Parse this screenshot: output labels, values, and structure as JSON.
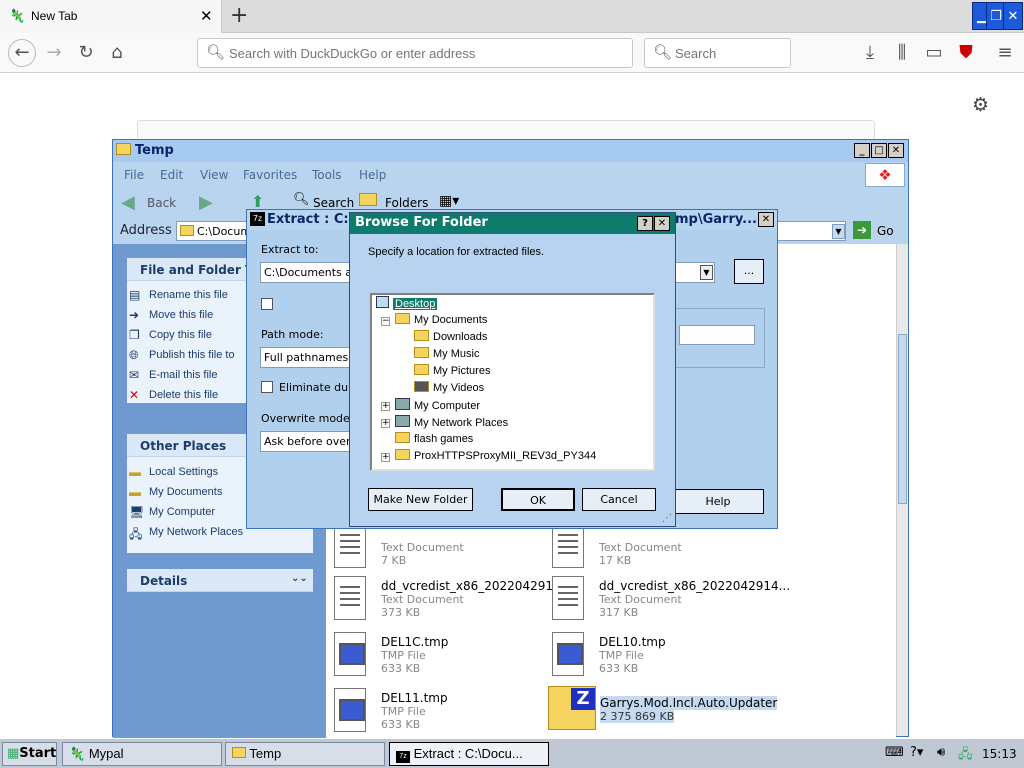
{
  "browser": {
    "tab_title": "New Tab",
    "url_placeholder": "Search with DuckDuckGo or enter address",
    "search_placeholder": "Search"
  },
  "explorer": {
    "title": "Temp",
    "menu": [
      "File",
      "Edit",
      "View",
      "Favorites",
      "Tools",
      "Help"
    ],
    "toolbar": {
      "back": "Back",
      "search": "Search",
      "folders": "Folders"
    },
    "address_label": "Address",
    "address_value": "C:\\Docum",
    "go_label": "Go",
    "file_tasks": {
      "heading": "File and Folder Tas",
      "items": [
        "Rename this file",
        "Move this file",
        "Copy this file",
        "Publish this file to",
        "E-mail this file",
        "Delete this file"
      ]
    },
    "other_places": {
      "heading": "Other Places",
      "items": [
        "Local Settings",
        "My Documents",
        "My Computer",
        "My Network Places"
      ]
    },
    "details_heading": "Details",
    "files": [
      {
        "name": "",
        "type": "Text Document",
        "size": "7 KB"
      },
      {
        "name": "",
        "type": "Text Document",
        "size": "17 KB"
      },
      {
        "name": "dd_vcredist_x86_2022042914...",
        "type": "Text Document",
        "size": "373 KB"
      },
      {
        "name": "dd_vcredist_x86_2022042914...",
        "type": "Text Document",
        "size": "317 KB"
      },
      {
        "name": "DEL1C.tmp",
        "type": "TMP File",
        "size": "633 KB"
      },
      {
        "name": "DEL10.tmp",
        "type": "TMP File",
        "size": "633 KB"
      },
      {
        "name": "DEL11.tmp",
        "type": "TMP File",
        "size": "633 KB"
      },
      {
        "name": "Garrys.Mod.Incl.Auto.Updater",
        "type": "",
        "size": "2 375 869 KB"
      }
    ]
  },
  "extract": {
    "title": "Extract : C:\\",
    "title_right": "mp\\Garry...",
    "extract_to_label": "Extract to:",
    "extract_to_value": "C:\\Documents and",
    "browse_button": "...",
    "path_mode_label": "Path mode:",
    "path_mode_value": "Full pathnames",
    "eliminate_label": "Eliminate duplic",
    "overwrite_label": "Overwrite mode:",
    "overwrite_value": "Ask before overw",
    "help_button": "Help"
  },
  "browse": {
    "title": "Browse For Folder",
    "description": "Specify a location for extracted files.",
    "tree": [
      "Desktop",
      "My Documents",
      "Downloads",
      "My Music",
      "My Pictures",
      "My Videos",
      "My Computer",
      "My Network Places",
      "flash games",
      "ProxHTTPSProxyMII_REV3d_PY344"
    ],
    "new_folder": "Make New Folder",
    "ok": "OK",
    "cancel": "Cancel"
  },
  "taskbar": {
    "start": "Start",
    "items": [
      "Mypal",
      "Temp",
      "Extract : C:\\Docu..."
    ],
    "clock": "15:13"
  }
}
